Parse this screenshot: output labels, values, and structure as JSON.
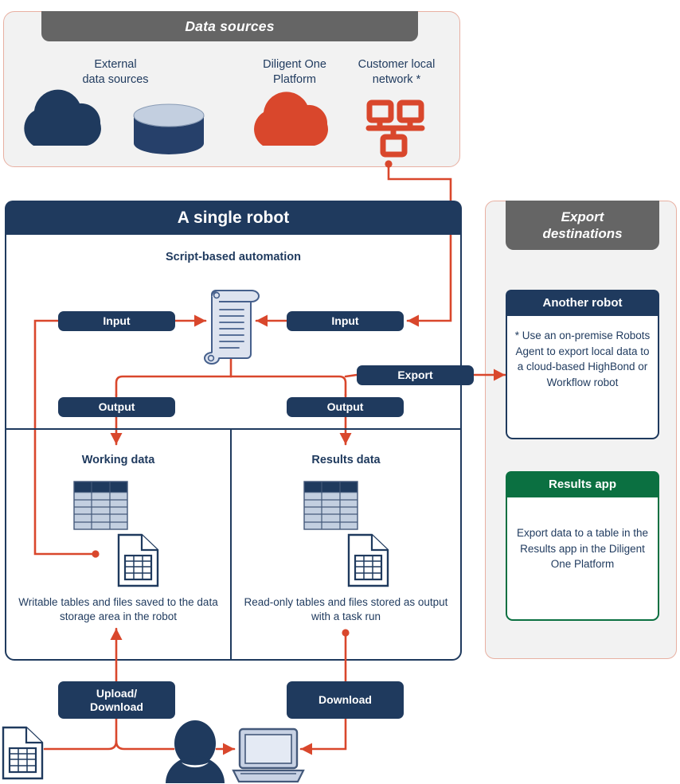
{
  "colors": {
    "navy": "#1f3a5e",
    "red": "#d9472c",
    "gray_header": "#656565",
    "panel_bg": "#f2f2f2",
    "panel_border": "#e8b0a2",
    "green": "#0b7041",
    "table_light": "#c3cfe0",
    "icon_light": "#d2dced"
  },
  "data_sources": {
    "title": "Data sources",
    "items": [
      {
        "label_line1": "External",
        "label_line2": "data sources",
        "icon": "cloud-icon"
      },
      {
        "label_line1": "",
        "label_line2": "",
        "icon": "database-cylinder-icon"
      },
      {
        "label_line1": "Diligent One",
        "label_line2": "Platform",
        "icon": "cloud-red-icon"
      },
      {
        "label_line1": "Customer local",
        "label_line2": "network *",
        "icon": "network-icon"
      }
    ]
  },
  "robot": {
    "title": "A single robot",
    "script_title": "Script-based automation",
    "script_icon": "scroll-script-icon",
    "pills": {
      "input_left": "Input",
      "input_right": "Input",
      "output_left": "Output",
      "output_right": "Output",
      "export": "Export"
    },
    "working": {
      "title": "Working data",
      "caption": "Writable tables and files saved to the data storage area in the robot",
      "table_icon": "data-table-icon",
      "file_icon": "spreadsheet-file-icon"
    },
    "results": {
      "title": "Results data",
      "caption": "Read-only tables and files stored as output with a task run",
      "table_icon": "data-table-icon",
      "file_icon": "spreadsheet-file-icon"
    }
  },
  "export_destinations": {
    "title_line1": "Export",
    "title_line2": "destinations",
    "cards": [
      {
        "header": "Another robot",
        "body": "* Use an on-premise Robots Agent to export local data to a cloud-based HighBond or Workflow robot",
        "accent": "#1f3a5e"
      },
      {
        "header": "Results app",
        "body": "Export data to a table in the Results app in the Diligent One Platform",
        "accent": "#0b7041"
      }
    ]
  },
  "bottom": {
    "upload_download_line1": "Upload/",
    "upload_download_line2": "Download",
    "download": "Download",
    "file_icon": "spreadsheet-file-icon",
    "user_icon": "user-person-icon",
    "laptop_icon": "laptop-icon"
  }
}
